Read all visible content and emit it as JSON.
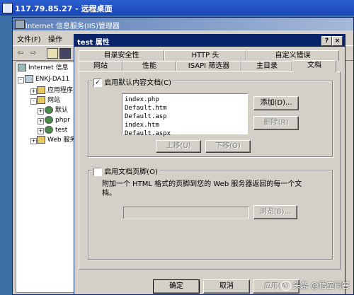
{
  "remote_desktop": {
    "title": "117.79.85.27 - 远程桌面"
  },
  "iis": {
    "title": "Internet 信息服务(IIS)管理器",
    "menu": {
      "file": "文件(F)",
      "action": "操作"
    },
    "tree": [
      {
        "label": "Internet 信息"
      },
      {
        "label": "ENKJ-DA11"
      },
      {
        "label": "应用程序"
      },
      {
        "label": "网站"
      },
      {
        "label": "默认"
      },
      {
        "label": "phpr"
      },
      {
        "label": "test"
      },
      {
        "label": "Web 服务"
      }
    ]
  },
  "dialog": {
    "title": "test 属性",
    "help_button": "?",
    "close_button": "×",
    "tabs_row1": [
      "目录安全性",
      "HTTP 头",
      "自定义错误"
    ],
    "tabs_row2": [
      "网站",
      "性能",
      "ISAPI 筛选器",
      "主目录",
      "文档"
    ],
    "active_tab": "文档",
    "default_doc": {
      "checked": true,
      "label": "启用默认内容文档(C)",
      "items": [
        "index.php",
        "Default.htm",
        "Default.asp",
        "index.htm",
        "Default.aspx"
      ],
      "add": "添加(D)...",
      "remove": "删除(R)",
      "move_up": "上移(U)",
      "move_down": "下移(O)"
    },
    "footer_doc": {
      "checked": false,
      "label": "启用文档页脚(O)",
      "description": "附加一个 HTML 格式的页脚到您的 Web 服务器返回的每一个文档。",
      "path": "",
      "browse": "浏览(B)..."
    },
    "buttons": {
      "ok": "确定",
      "cancel": "取消",
      "apply": "应用(A)"
    }
  },
  "watermark": "头条 @悟空问答"
}
